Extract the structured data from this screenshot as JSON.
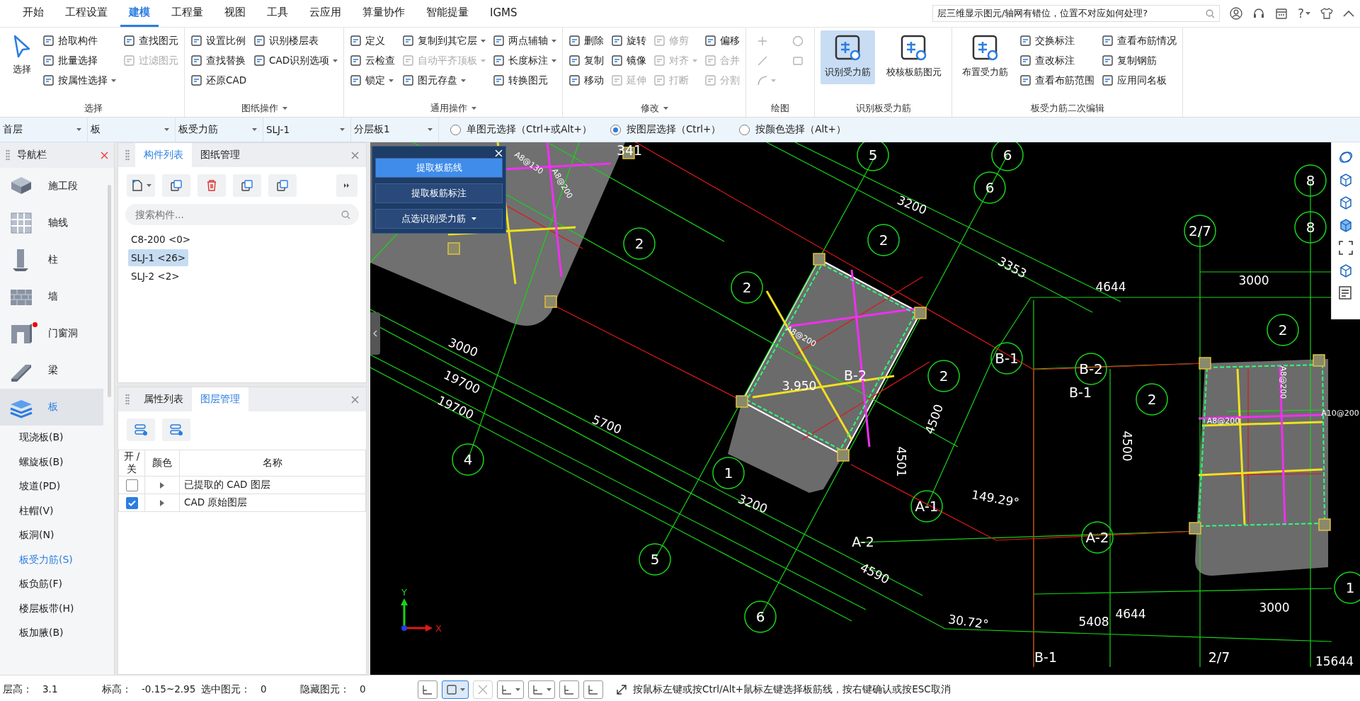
{
  "menu_tabs": [
    {
      "label": "开始",
      "selected": false
    },
    {
      "label": "工程设置",
      "selected": false
    },
    {
      "label": "建模",
      "selected": true
    },
    {
      "label": "工程量",
      "selected": false
    },
    {
      "label": "视图",
      "selected": false
    },
    {
      "label": "工具",
      "selected": false
    },
    {
      "label": "云应用",
      "selected": false
    },
    {
      "label": "算量协作",
      "selected": false
    },
    {
      "label": "智能提量",
      "selected": false
    },
    {
      "label": "IGMS",
      "selected": false
    }
  ],
  "help_search": {
    "value": "层三维显示图元/轴网有错位，位置不对应如何处理?"
  },
  "help_label": "?",
  "ribbon_groups": [
    {
      "title": "选择",
      "has_menu": false,
      "tools": [
        {
          "label": "选择",
          "kind": "large",
          "selected": false,
          "disabled": false,
          "dropdown": false
        },
        {
          "label": "拾取构件",
          "kind": "small",
          "selected": false,
          "disabled": false,
          "dropdown": false
        },
        {
          "label": "批量选择",
          "kind": "small",
          "selected": false,
          "disabled": false,
          "dropdown": false
        },
        {
          "label": "按属性选择",
          "kind": "small",
          "selected": false,
          "disabled": false,
          "dropdown": true
        },
        {
          "label": "查找图元",
          "kind": "small",
          "selected": false,
          "disabled": false,
          "dropdown": false
        },
        {
          "label": "过滤图元",
          "kind": "small",
          "selected": false,
          "disabled": true,
          "dropdown": false
        }
      ]
    },
    {
      "title": "图纸操作",
      "has_menu": true,
      "tools": [
        {
          "label": "设置比例",
          "kind": "small",
          "selected": false,
          "disabled": false,
          "dropdown": false
        },
        {
          "label": "查找替换",
          "kind": "small",
          "selected": false,
          "disabled": false,
          "dropdown": false
        },
        {
          "label": "还原CAD",
          "kind": "small",
          "selected": false,
          "disabled": false,
          "dropdown": false
        },
        {
          "label": "识别楼层表",
          "kind": "small",
          "selected": false,
          "disabled": false,
          "dropdown": false
        },
        {
          "label": "CAD识别选项",
          "kind": "small",
          "selected": false,
          "disabled": false,
          "dropdown": true
        }
      ]
    },
    {
      "title": "通用操作",
      "has_menu": true,
      "tools": [
        {
          "label": "定义",
          "kind": "small",
          "selected": false,
          "disabled": false,
          "dropdown": false
        },
        {
          "label": "云检查",
          "kind": "small",
          "selected": false,
          "disabled": false,
          "dropdown": false
        },
        {
          "label": "锁定",
          "kind": "small",
          "selected": false,
          "disabled": false,
          "dropdown": true
        },
        {
          "label": "复制到其它层",
          "kind": "small",
          "selected": false,
          "disabled": false,
          "dropdown": true
        },
        {
          "label": "自动平齐顶板",
          "kind": "small",
          "selected": false,
          "disabled": true,
          "dropdown": true
        },
        {
          "label": "图元存盘",
          "kind": "small",
          "selected": false,
          "disabled": false,
          "dropdown": true
        },
        {
          "label": "两点辅轴",
          "kind": "small",
          "selected": false,
          "disabled": false,
          "dropdown": true
        },
        {
          "label": "长度标注",
          "kind": "small",
          "selected": false,
          "disabled": false,
          "dropdown": true
        },
        {
          "label": "转换图元",
          "kind": "small",
          "selected": false,
          "disabled": false,
          "dropdown": false
        }
      ]
    },
    {
      "title": "修改",
      "has_menu": true,
      "tools": [
        {
          "label": "删除",
          "kind": "small",
          "selected": false,
          "disabled": false,
          "dropdown": false
        },
        {
          "label": "复制",
          "kind": "small",
          "selected": false,
          "disabled": false,
          "dropdown": false
        },
        {
          "label": "移动",
          "kind": "small",
          "selected": false,
          "disabled": false,
          "dropdown": false
        },
        {
          "label": "旋转",
          "kind": "small",
          "selected": false,
          "disabled": false,
          "dropdown": false
        },
        {
          "label": "镜像",
          "kind": "small",
          "selected": false,
          "disabled": false,
          "dropdown": false
        },
        {
          "label": "延伸",
          "kind": "small",
          "selected": false,
          "disabled": true,
          "dropdown": false
        },
        {
          "label": "修剪",
          "kind": "small",
          "selected": false,
          "disabled": true,
          "dropdown": false
        },
        {
          "label": "对齐",
          "kind": "small",
          "selected": false,
          "disabled": true,
          "dropdown": true
        },
        {
          "label": "打断",
          "kind": "small",
          "selected": false,
          "disabled": true,
          "dropdown": false
        },
        {
          "label": "偏移",
          "kind": "small",
          "selected": false,
          "disabled": false,
          "dropdown": false
        },
        {
          "label": "合并",
          "kind": "small",
          "selected": false,
          "disabled": true,
          "dropdown": false
        },
        {
          "label": "分割",
          "kind": "small",
          "selected": false,
          "disabled": true,
          "dropdown": false
        }
      ]
    },
    {
      "title": "绘图",
      "has_menu": false,
      "tools": [
        {
          "kind": "icon",
          "selected": false,
          "disabled": true,
          "dropdown": false
        },
        {
          "kind": "icon",
          "selected": false,
          "disabled": true,
          "dropdown": false
        },
        {
          "kind": "icon",
          "selected": false,
          "disabled": true,
          "dropdown": true
        },
        {
          "kind": "icon",
          "selected": false,
          "disabled": true,
          "dropdown": false
        },
        {
          "kind": "icon",
          "selected": false,
          "disabled": true,
          "dropdown": false
        }
      ]
    },
    {
      "title": "识别板受力筋",
      "has_menu": false,
      "tools": [
        {
          "label": "识别受力筋",
          "kind": "large",
          "selected": true,
          "disabled": false,
          "dropdown": false
        },
        {
          "label": "校核板筋图元",
          "kind": "large",
          "selected": false,
          "disabled": false,
          "dropdown": false
        }
      ]
    },
    {
      "title": "板受力筋二次编辑",
      "has_menu": false,
      "tools": [
        {
          "label": "布置受力筋",
          "kind": "large",
          "selected": false,
          "disabled": false,
          "dropdown": false
        },
        {
          "label": "交换标注",
          "kind": "small",
          "selected": false,
          "disabled": false,
          "dropdown": false
        },
        {
          "label": "查改标注",
          "kind": "small",
          "selected": false,
          "disabled": false,
          "dropdown": false
        },
        {
          "label": "查看布筋范围",
          "kind": "small",
          "selected": false,
          "disabled": false,
          "dropdown": false
        },
        {
          "label": "查看布筋情况",
          "kind": "small",
          "selected": false,
          "disabled": false,
          "dropdown": false
        },
        {
          "label": "复制钢筋",
          "kind": "small",
          "selected": false,
          "disabled": false,
          "dropdown": false
        },
        {
          "label": "应用同名板",
          "kind": "small",
          "selected": false,
          "disabled": false,
          "dropdown": false
        }
      ]
    }
  ],
  "selectors": [
    {
      "value": "首层"
    },
    {
      "value": "板"
    },
    {
      "value": "板受力筋"
    },
    {
      "value": "SLJ-1"
    },
    {
      "value": "分层板1"
    }
  ],
  "selection_modes": [
    {
      "label": "单图元选择（Ctrl+或Alt+）",
      "selected": false
    },
    {
      "label": "按图层选择（Ctrl+）",
      "selected": true
    },
    {
      "label": "按颜色选择（Alt+）",
      "selected": false
    }
  ],
  "nav": {
    "title": "导航栏",
    "categories": [
      {
        "label": "施工段",
        "selected": false,
        "badge": false
      },
      {
        "label": "轴线",
        "selected": false,
        "badge": false
      },
      {
        "label": "柱",
        "selected": false,
        "badge": false
      },
      {
        "label": "墙",
        "selected": false,
        "badge": false
      },
      {
        "label": "门窗洞",
        "selected": false,
        "badge": true
      },
      {
        "label": "梁",
        "selected": false,
        "badge": false
      },
      {
        "label": "板",
        "selected": true,
        "badge": false,
        "children": [
          {
            "label": "现浇板(B)",
            "selected": false
          },
          {
            "label": "螺旋板(B)",
            "selected": false
          },
          {
            "label": "坡道(PD)",
            "selected": false
          },
          {
            "label": "柱帽(V)",
            "selected": false
          },
          {
            "label": "板洞(N)",
            "selected": false
          },
          {
            "label": "板受力筋(S)",
            "selected": true
          },
          {
            "label": "板负筋(F)",
            "selected": false
          },
          {
            "label": "楼层板带(H)",
            "selected": false
          },
          {
            "label": "板加腋(B)",
            "selected": false
          }
        ]
      }
    ]
  },
  "component_panel": {
    "tabs": [
      {
        "label": "构件列表",
        "selected": true
      },
      {
        "label": "图纸管理",
        "selected": false
      }
    ],
    "search": {
      "placeholder": "搜索构件..."
    },
    "items": [
      {
        "label": "C8-200 <0>",
        "selected": false
      },
      {
        "label": "SLJ-1 <26>",
        "selected": true
      },
      {
        "label": "SLJ-2 <2>",
        "selected": false
      }
    ]
  },
  "layer_panel": {
    "tabs": [
      {
        "label": "属性列表",
        "selected": false
      },
      {
        "label": "图层管理",
        "selected": true
      }
    ],
    "columns": [
      "开 / 关",
      "颜色",
      "名称"
    ],
    "rows": [
      {
        "checked": false,
        "name": "已提取的 CAD 图层"
      },
      {
        "checked": true,
        "name": "CAD 原始图层"
      }
    ]
  },
  "float_panel": {
    "buttons": [
      {
        "label": "提取板筋线",
        "selected": true,
        "dropdown": false
      },
      {
        "label": "提取板筋标注",
        "selected": false,
        "dropdown": false
      },
      {
        "label": "点选识别受力筋",
        "selected": false,
        "dropdown": true
      }
    ]
  },
  "cad_labels": [
    {
      "text": "5",
      "kind": "bubble"
    },
    {
      "text": "6",
      "kind": "bubble"
    },
    {
      "text": "6",
      "kind": "bubble"
    },
    {
      "text": "2",
      "kind": "bubble"
    },
    {
      "text": "2",
      "kind": "bubble"
    },
    {
      "text": "2",
      "kind": "bubble"
    },
    {
      "text": "2",
      "kind": "bubble"
    },
    {
      "text": "2",
      "kind": "bubble"
    },
    {
      "text": "2",
      "kind": "bubble"
    },
    {
      "text": "1",
      "kind": "bubble"
    },
    {
      "text": "4",
      "kind": "bubble"
    },
    {
      "text": "5",
      "kind": "bubble"
    },
    {
      "text": "6",
      "kind": "bubble"
    },
    {
      "text": "8",
      "kind": "bubble"
    },
    {
      "text": "8",
      "kind": "bubble"
    },
    {
      "text": "2/7",
      "kind": "bubble"
    },
    {
      "text": "B-1",
      "kind": "bubble"
    },
    {
      "text": "B-2",
      "kind": "bubble"
    },
    {
      "text": "A-1",
      "kind": "bubble"
    },
    {
      "text": "A-2",
      "kind": "bubble"
    },
    {
      "text": "1",
      "kind": "bubble"
    },
    {
      "text": "3200",
      "kind": "dimension"
    },
    {
      "text": "3353",
      "kind": "dimension"
    },
    {
      "text": "4644",
      "kind": "dimension"
    },
    {
      "text": "3000",
      "kind": "dimension"
    },
    {
      "text": "3000",
      "kind": "dimension"
    },
    {
      "text": "19700",
      "kind": "dimension"
    },
    {
      "text": "19700",
      "kind": "dimension"
    },
    {
      "text": "5700",
      "kind": "dimension"
    },
    {
      "text": "B-2",
      "kind": "name"
    },
    {
      "text": "3.950",
      "kind": "dimension"
    },
    {
      "text": "4501",
      "kind": "dimension"
    },
    {
      "text": "4500",
      "kind": "dimension"
    },
    {
      "text": "B-1",
      "kind": "name"
    },
    {
      "text": "4500",
      "kind": "dimension"
    },
    {
      "text": "149.29°",
      "kind": "dimension"
    },
    {
      "text": "A-2",
      "kind": "name"
    },
    {
      "text": "3200",
      "kind": "dimension"
    },
    {
      "text": "4590",
      "kind": "dimension"
    },
    {
      "text": "30.72°",
      "kind": "dimension"
    },
    {
      "text": "5408",
      "kind": "dimension"
    },
    {
      "text": "4644",
      "kind": "dimension"
    },
    {
      "text": "3000",
      "kind": "dimension"
    },
    {
      "text": "B-1",
      "kind": "name"
    },
    {
      "text": "2/7",
      "kind": "name"
    },
    {
      "text": "15644",
      "kind": "dimension"
    },
    {
      "text": "A8@130",
      "kind": "rebar"
    },
    {
      "text": "A8@200",
      "kind": "rebar"
    },
    {
      "text": "A8@200",
      "kind": "rebar"
    },
    {
      "text": "A8@200",
      "kind": "rebar"
    },
    {
      "text": "A8@200",
      "kind": "rebar"
    },
    {
      "text": "A10@200",
      "kind": "rebar"
    },
    {
      "text": "341",
      "kind": "name"
    }
  ],
  "axis_indicator": {
    "x": "X",
    "y": "Y"
  },
  "status": {
    "fields": [
      {
        "label": "层高：",
        "value": "3.1"
      },
      {
        "label": "标高：",
        "value": "-0.15~2.95"
      },
      {
        "label": "选中图元：",
        "value": "0"
      },
      {
        "label": "隐藏图元：",
        "value": "0"
      }
    ],
    "tools": [
      {
        "selected": false,
        "disabled": false,
        "dropdown": false
      },
      {
        "selected": true,
        "disabled": false,
        "dropdown": true
      },
      {
        "selected": false,
        "disabled": true,
        "dropdown": false
      },
      {
        "selected": false,
        "disabled": false,
        "dropdown": true
      },
      {
        "selected": false,
        "disabled": false,
        "dropdown": true
      },
      {
        "selected": false,
        "disabled": false,
        "dropdown": false
      },
      {
        "selected": false,
        "disabled": false,
        "dropdown": false
      }
    ],
    "hint": "按鼠标左键或按Ctrl/Alt+鼠标左键选择板筋线，按右键确认或按ESC取消"
  }
}
